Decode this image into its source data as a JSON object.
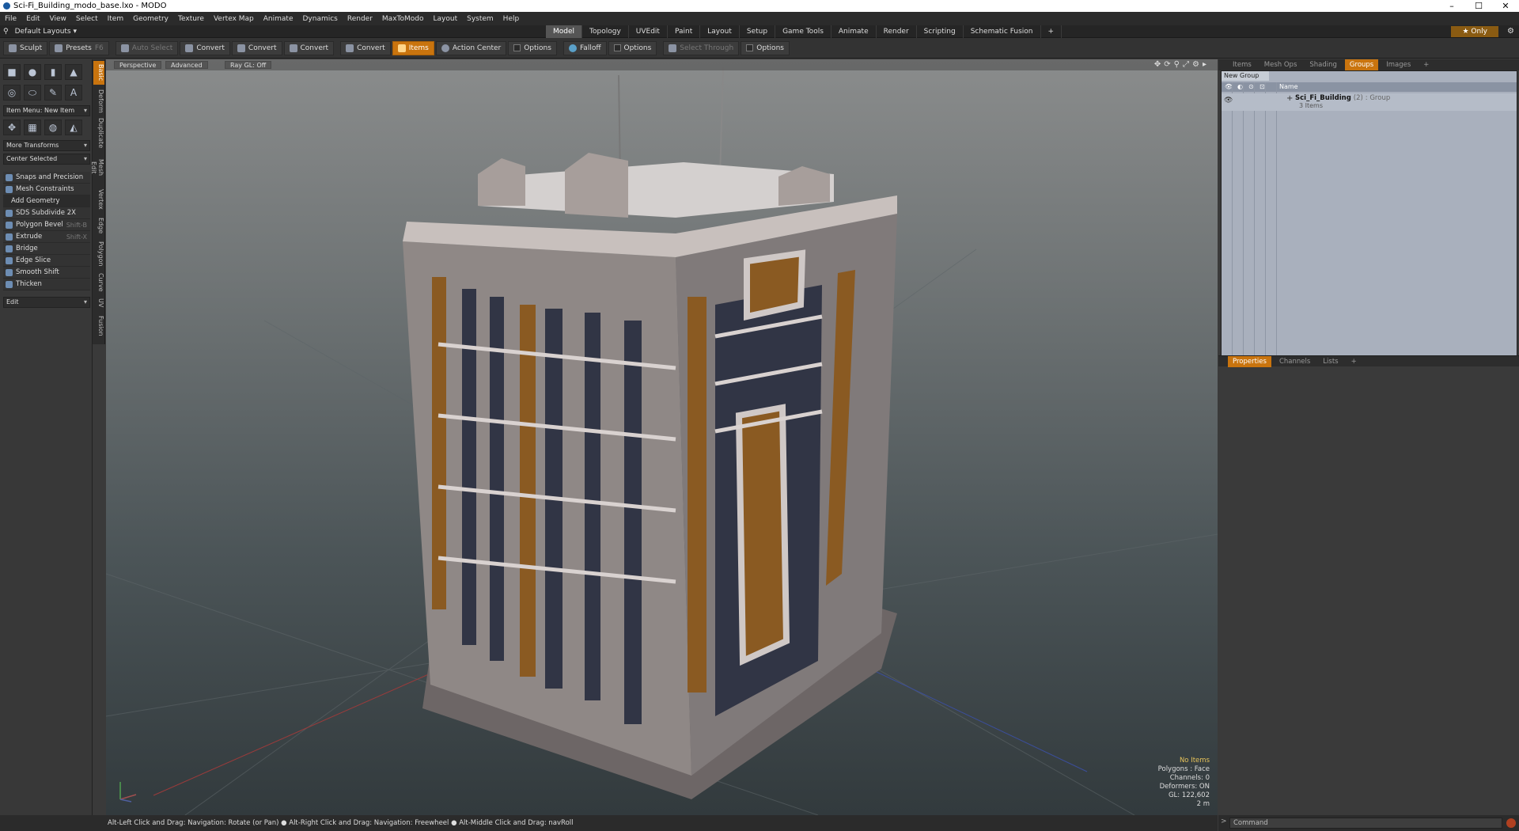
{
  "window": {
    "title": "Sci-Fi_Building_modo_base.lxo - MODO",
    "minimize": "–",
    "maximize": "☐",
    "close": "✕"
  },
  "menu": [
    "File",
    "Edit",
    "View",
    "Select",
    "Item",
    "Geometry",
    "Texture",
    "Vertex Map",
    "Animate",
    "Dynamics",
    "Render",
    "MaxToModo",
    "Layout",
    "System",
    "Help"
  ],
  "layout": {
    "selector": "Default Layouts ▾",
    "tabs": [
      "Model",
      "Topology",
      "UVEdit",
      "Paint",
      "Layout",
      "Setup",
      "Game Tools",
      "Animate",
      "Render",
      "Scripting",
      "Schematic Fusion",
      "+"
    ],
    "active_tab": "Model",
    "only": "★ Only"
  },
  "toolbar": {
    "sculpt": "Sculpt",
    "presets": "Presets",
    "presets_key": "F6",
    "auto_select": "Auto Select",
    "convert": "Convert",
    "items": "Items",
    "action_center": "Action Center",
    "options": "Options",
    "falloff": "Falloff",
    "select_through": "Select Through"
  },
  "left_panel": {
    "item_menu": "Item Menu: New Item",
    "more_transforms": "More Transforms",
    "center_selected": "Center Selected",
    "snaps": "Snaps and Precision",
    "mesh_constraints": "Mesh Constraints",
    "add_geometry": "Add Geometry",
    "tools": [
      {
        "label": "SDS Subdivide 2X",
        "shortcut": ""
      },
      {
        "label": "Polygon Bevel",
        "shortcut": "Shift-B"
      },
      {
        "label": "Extrude",
        "shortcut": "Shift-X"
      },
      {
        "label": "Bridge",
        "shortcut": ""
      },
      {
        "label": "Edge Slice",
        "shortcut": ""
      },
      {
        "label": "Smooth Shift",
        "shortcut": ""
      },
      {
        "label": "Thicken",
        "shortcut": ""
      }
    ],
    "edit": "Edit"
  },
  "vertical_tabs": [
    "Basic",
    "Deform",
    "Duplicate",
    "Mesh Edit",
    "Vertex",
    "Edge",
    "Polygon",
    "Curve",
    "UV",
    "Fusion"
  ],
  "viewport": {
    "view": "Perspective",
    "shading": "Advanced",
    "raygl": "Ray GL: Off",
    "hud": {
      "items": "No Items",
      "polygons": "Polygons : Face",
      "channels": "Channels: 0",
      "deformers": "Deformers: ON",
      "gl": "GL: 122,602",
      "scale": "2 m"
    }
  },
  "right_panel": {
    "top_tabs": [
      "Items",
      "Mesh Ops",
      "Shading",
      "Groups",
      "Images",
      "+"
    ],
    "active_top": "Groups",
    "new_group": "New Group",
    "name_col": "Name",
    "group": {
      "name": "Sci_Fi_Building",
      "count": "(2)",
      "type": ": Group",
      "sub": "3 Items"
    },
    "bottom_tabs": [
      "Properties",
      "Channels",
      "Lists",
      "+"
    ],
    "active_bottom": "Properties"
  },
  "status_line": "Alt-Left Click and Drag: Navigation: Rotate (or Pan) ● Alt-Right Click and Drag: Navigation: Freewheel ● Alt-Middle Click and Drag: navRoll",
  "command": {
    "placeholder": "Command"
  },
  "colors": {
    "accent": "#c9740e",
    "viewport_bg": "#4c5558"
  }
}
